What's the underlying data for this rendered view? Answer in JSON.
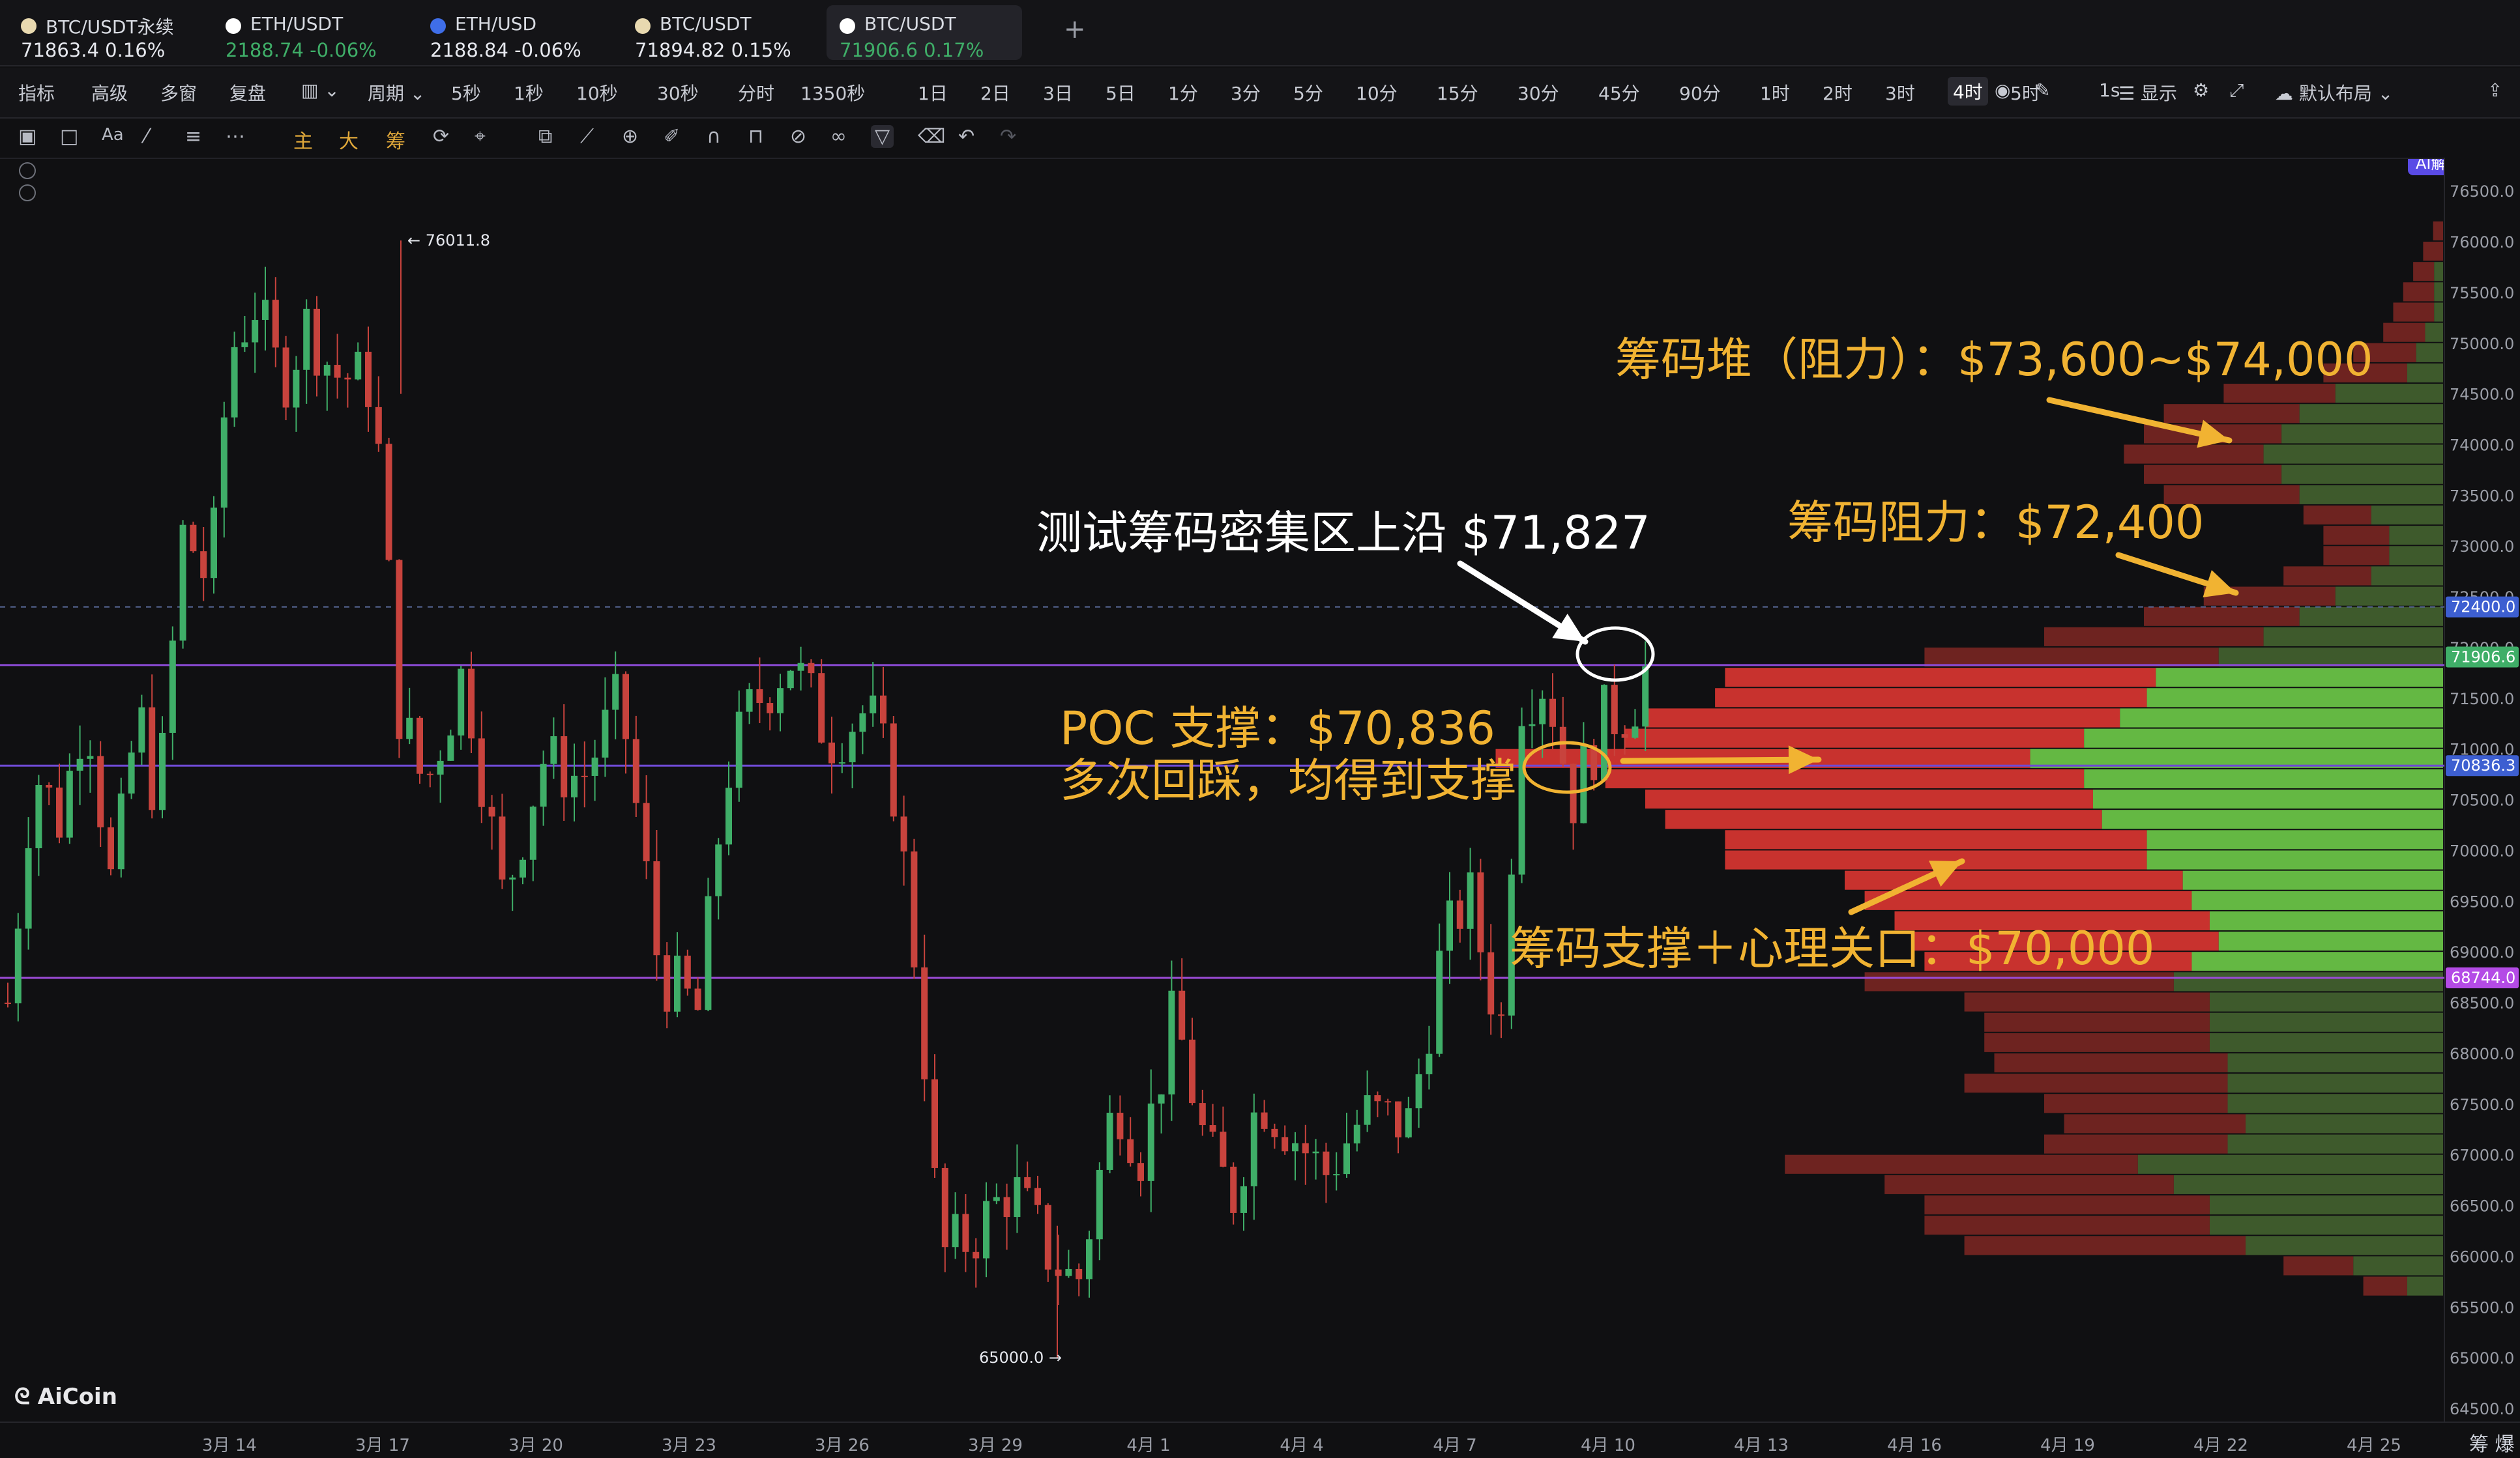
{
  "tabs": [
    {
      "name": "BTC/USDT永续",
      "quote": "71863.4  0.16%",
      "dot": "#e8d9b0",
      "quoteColor": "#e6e8ee",
      "active": false
    },
    {
      "name": "ETH/USDT",
      "quote": "2188.74  -0.06%",
      "dot": "#ffffff",
      "quoteColor": "#3fae68",
      "active": false
    },
    {
      "name": "ETH/USD",
      "quote": "2188.84  -0.06%",
      "dot": "#3f6ee8",
      "quoteColor": "#e6e8ee",
      "active": false
    },
    {
      "name": "BTC/USDT",
      "quote": "71894.82  0.15%",
      "dot": "#e8d9b0",
      "quoteColor": "#e6e8ee",
      "active": false
    },
    {
      "name": "BTC/USDT",
      "quote": "71906.6  0.17%",
      "dot": "#ffffff",
      "quoteColor": "#3fae68",
      "active": true
    }
  ],
  "tab_add": "+",
  "toolbar": {
    "left": [
      "指标",
      "高级",
      "多窗",
      "复盘"
    ],
    "period_label": "周期",
    "periods": [
      "5秒",
      "1秒",
      "10秒",
      "30秒",
      "分时",
      "1350秒",
      "1日",
      "2日",
      "3日",
      "5日",
      "1分",
      "3分",
      "5分",
      "10分",
      "15分",
      "30分",
      "45分",
      "90分",
      "1时",
      "2时",
      "3时",
      "4时",
      "5时",
      "1s"
    ],
    "selected_period": "4时",
    "display": "显示",
    "layout": "默认布局",
    "ai": "AI解读"
  },
  "drawbar": {
    "main": "主",
    "big": "大",
    "chips": "筹"
  },
  "price_axis": {
    "ticks": [
      "76500.0",
      "76000.0",
      "75500.0",
      "75000.0",
      "74500.0",
      "74000.0",
      "73500.0",
      "73000.0",
      "72500.0",
      "72000.0",
      "71500.0",
      "71000.0",
      "70500.0",
      "70000.0",
      "69500.0",
      "69000.0",
      "68500.0",
      "68000.0",
      "67500.0",
      "67000.0",
      "66500.0",
      "66000.0",
      "65500.0",
      "65000.0",
      "64500.0"
    ],
    "range": [
      64500,
      76700
    ],
    "tags": [
      {
        "label": "72400.0",
        "value": 72400,
        "color": "#3d5fd1"
      },
      {
        "label": "71906.6",
        "value": 71906.6,
        "color": "#3fae68"
      },
      {
        "label": "70836.3",
        "value": 70836.3,
        "color": "#3d5fd1"
      },
      {
        "label": "68744.0",
        "value": 68744,
        "color": "#b44be6"
      }
    ]
  },
  "x_axis": [
    "3月 14",
    "3月 17",
    "3月 20",
    "3月 23",
    "3月 26",
    "3月 29",
    "4月 1",
    "4月 4",
    "4月 7",
    "4月 10",
    "4月 13",
    "4月 16",
    "4月 19",
    "4月 22",
    "4月 25"
  ],
  "markers": {
    "high": "← 76011.8",
    "low": "65000.0 →"
  },
  "annotations": {
    "test_upper": "测试筹码密集区上沿 $71,827",
    "resistance_pile": "筹码堆（阻力）：$73,600~$74,000",
    "resistance": "筹码阻力：$72,400",
    "poc_line1": "POC 支撑：$70,836",
    "poc_line2": "多次回踩，均得到支撑",
    "support": "筹码支撑＋心理关口：$70,000"
  },
  "logo": "AiCoin",
  "axis_corner": "筹  爆",
  "colors": {
    "up": "#3fae68",
    "down": "#c8433d",
    "annotation": "#f1b332"
  }
}
